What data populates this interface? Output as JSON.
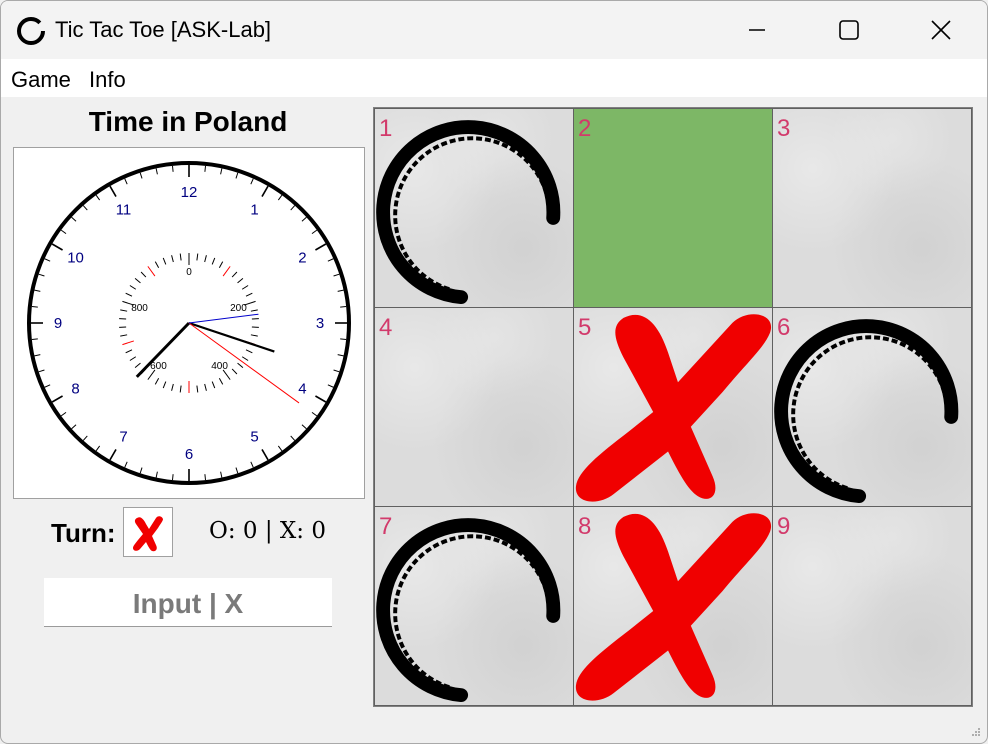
{
  "window": {
    "title": "Tic Tac Toe [ASK-Lab]",
    "controls": [
      "minimize",
      "maximize",
      "close"
    ]
  },
  "menu": {
    "items": [
      "Game",
      "Info"
    ]
  },
  "clock": {
    "title": "Time in Poland",
    "hour_numbers": [
      "12",
      "1",
      "2",
      "3",
      "4",
      "5",
      "6",
      "7",
      "8",
      "9",
      "10",
      "11"
    ],
    "ms_dial_labels": [
      "0",
      "200",
      "400",
      "600",
      "800"
    ],
    "time": {
      "hours": 3,
      "minutes": 37,
      "seconds": 21,
      "ms_hand_value": 230
    },
    "colors": {
      "hour_numbers": "#000080",
      "second_hand": "#ff0000",
      "ms_hand": "#0000cc",
      "hands": "#000000"
    }
  },
  "status": {
    "turn_label": "Turn:",
    "turn_icon": "red-x-icon",
    "score": "O: 0 | X: 0"
  },
  "input_button": {
    "label": "Input | X"
  },
  "board": {
    "cells": [
      {
        "num": "1",
        "mark": "O",
        "highlight": false
      },
      {
        "num": "2",
        "mark": "",
        "highlight": true
      },
      {
        "num": "3",
        "mark": "",
        "highlight": false
      },
      {
        "num": "4",
        "mark": "",
        "highlight": false
      },
      {
        "num": "5",
        "mark": "X",
        "highlight": false
      },
      {
        "num": "6",
        "mark": "O",
        "highlight": false
      },
      {
        "num": "7",
        "mark": "O",
        "highlight": false
      },
      {
        "num": "8",
        "mark": "X",
        "highlight": false
      },
      {
        "num": "9",
        "mark": "",
        "highlight": false
      }
    ],
    "colors": {
      "x_mark": "#f00000",
      "o_mark": "#000000",
      "cell_number": "#d23a6b",
      "highlight": "#7db766"
    }
  }
}
